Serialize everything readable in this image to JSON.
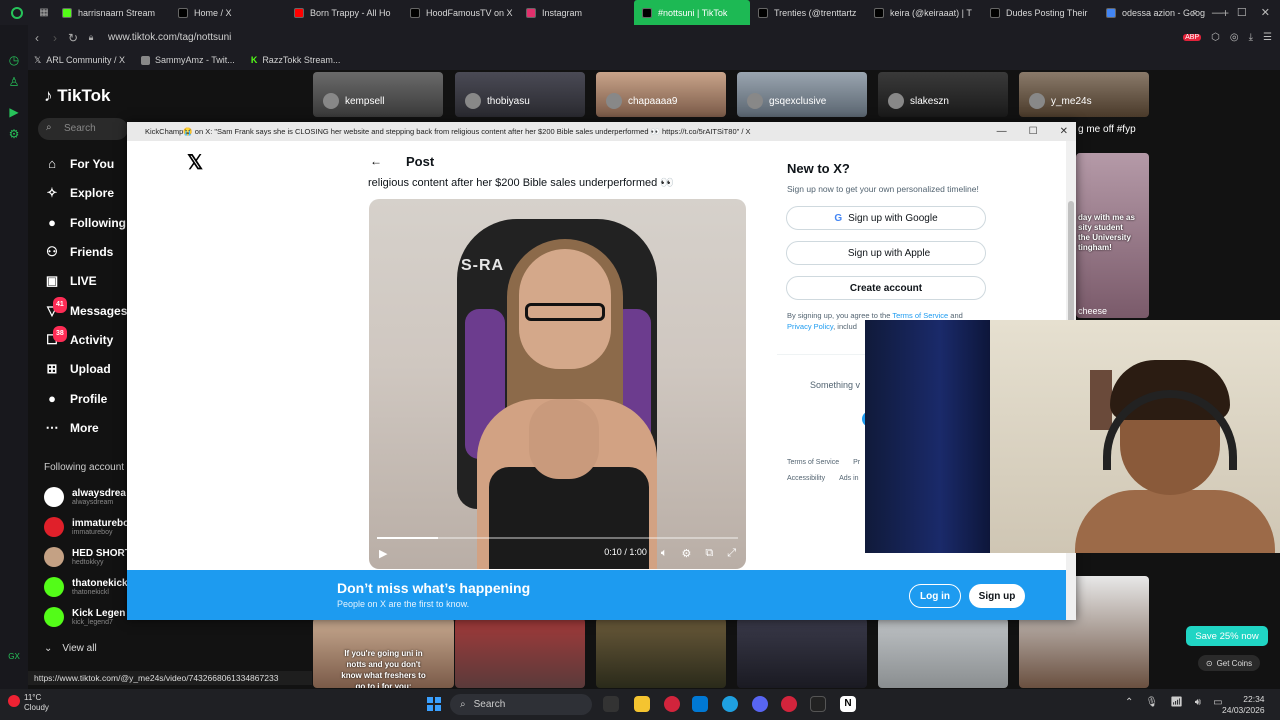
{
  "browser": {
    "tabs": [
      {
        "label": "harrisnaarn Stream",
        "color": "#53fc18",
        "active": false
      },
      {
        "label": "Home / X",
        "color": "#000000",
        "active": false
      },
      {
        "label": "Born Trappy - All Ho",
        "color": "#ff0000",
        "active": false
      },
      {
        "label": "HoodFamousTV on X",
        "color": "#000000",
        "active": false
      },
      {
        "label": "Instagram",
        "color": "#e1306c",
        "active": false
      },
      {
        "label": "#nottsuni | TikTok",
        "color": "#000000",
        "active": true
      },
      {
        "label": "Trenties (@trenttartz",
        "color": "#000000",
        "active": false
      },
      {
        "label": "keira (@keiraaat) | T",
        "color": "#000000",
        "active": false
      },
      {
        "label": "Dudes Posting Their",
        "color": "#000000",
        "active": false
      },
      {
        "label": "odessa azion - Goog",
        "color": "#4285f4",
        "active": false
      }
    ],
    "url": "www.tiktok.com/tag/nottsuni",
    "bookmarks": [
      "ARL Community / X",
      "SammyAmz - Twit...",
      "RazzTokk Stream..."
    ],
    "status_url": "https://www.tiktok.com/@y_me24s/video/7432668061334867233"
  },
  "tiktok": {
    "logo": "TikTok",
    "search_placeholder": "Search",
    "nav": [
      {
        "label": "For You",
        "icon": "home-icon"
      },
      {
        "label": "Explore",
        "icon": "compass-icon"
      },
      {
        "label": "Following",
        "icon": "following-icon"
      },
      {
        "label": "Friends",
        "icon": "friends-icon"
      },
      {
        "label": "LIVE",
        "icon": "live-icon"
      },
      {
        "label": "Messages",
        "icon": "messages-icon",
        "badge": "41"
      },
      {
        "label": "Activity",
        "icon": "activity-icon",
        "badge": "38"
      },
      {
        "label": "Upload",
        "icon": "upload-icon"
      },
      {
        "label": "Profile",
        "icon": "profile-icon"
      },
      {
        "label": "More",
        "icon": "more-icon"
      }
    ],
    "following_title": "Following account",
    "following": [
      {
        "name": "alwaysdrea",
        "handle": "alwaysdream",
        "color": "#ffffff"
      },
      {
        "name": "immaturebo",
        "handle": "immatureboy",
        "color": "#e0202a"
      },
      {
        "name": "HED SHORT",
        "handle": "hedtokkyy",
        "color": "#c4a184"
      },
      {
        "name": "thatonekick",
        "handle": "thatonekickl",
        "color": "#53fc18"
      },
      {
        "name": "Kick Legen",
        "handle": "kick_legend7",
        "color": "#53fc18"
      }
    ],
    "view_all": "View all",
    "top_thumbs": [
      "kempsell",
      "thobiyasu",
      "chapaaaa9",
      "gsqexclusive",
      "slakeszn",
      "y_me24s"
    ],
    "side_caption": "g me off #fyp",
    "side_caption2": "cheese",
    "side_overlay": "day with me as\nsity student\nthe University\ntingham!",
    "bottom_thumb_text": "If you're going uni in\nnotts and you don't\nknow what freshers to\ngo to i for you:",
    "save_btn": "Save 25% now",
    "coins_btn": "Get Coins"
  },
  "popup": {
    "title": "KickChamp😭 on X: \"Sam Frank says she is CLOSING her website and stepping back from religious content after her $200 Bible sales underperformed 👀 https://t.co/5rAITSiT80\" / X",
    "post_header": "Post",
    "post_text": "religious content after her $200 Bible sales underperformed 👀",
    "video": {
      "time": "0:10 / 1:00",
      "progress": 0.17,
      "chair_text": "S-RA"
    },
    "new_title": "New to X?",
    "new_sub": "Sign up now to get your own personalized timeline!",
    "google_btn": "Sign up with Google",
    "apple_btn": "Sign up with Apple",
    "create_btn": "Create account",
    "terms_prefix": "By signing up, you agree to the ",
    "terms_link": "Terms of Service",
    "terms_mid": " and",
    "privacy_link": "Privacy Policy",
    "terms_suffix": ", includ",
    "something": "Something v",
    "footer_row1": [
      "Terms of Service",
      "Pr"
    ],
    "footer_row2": [
      "Accessibility",
      "Ads in"
    ],
    "banner_title": "Don’t miss what’s happening",
    "banner_sub": "People on X are the first to know.",
    "login": "Log in",
    "signup": "Sign up"
  },
  "taskbar": {
    "temp": "11°C",
    "weather": "Cloudy",
    "search": "Search",
    "time": "22:34",
    "date": "24/03/2026"
  }
}
